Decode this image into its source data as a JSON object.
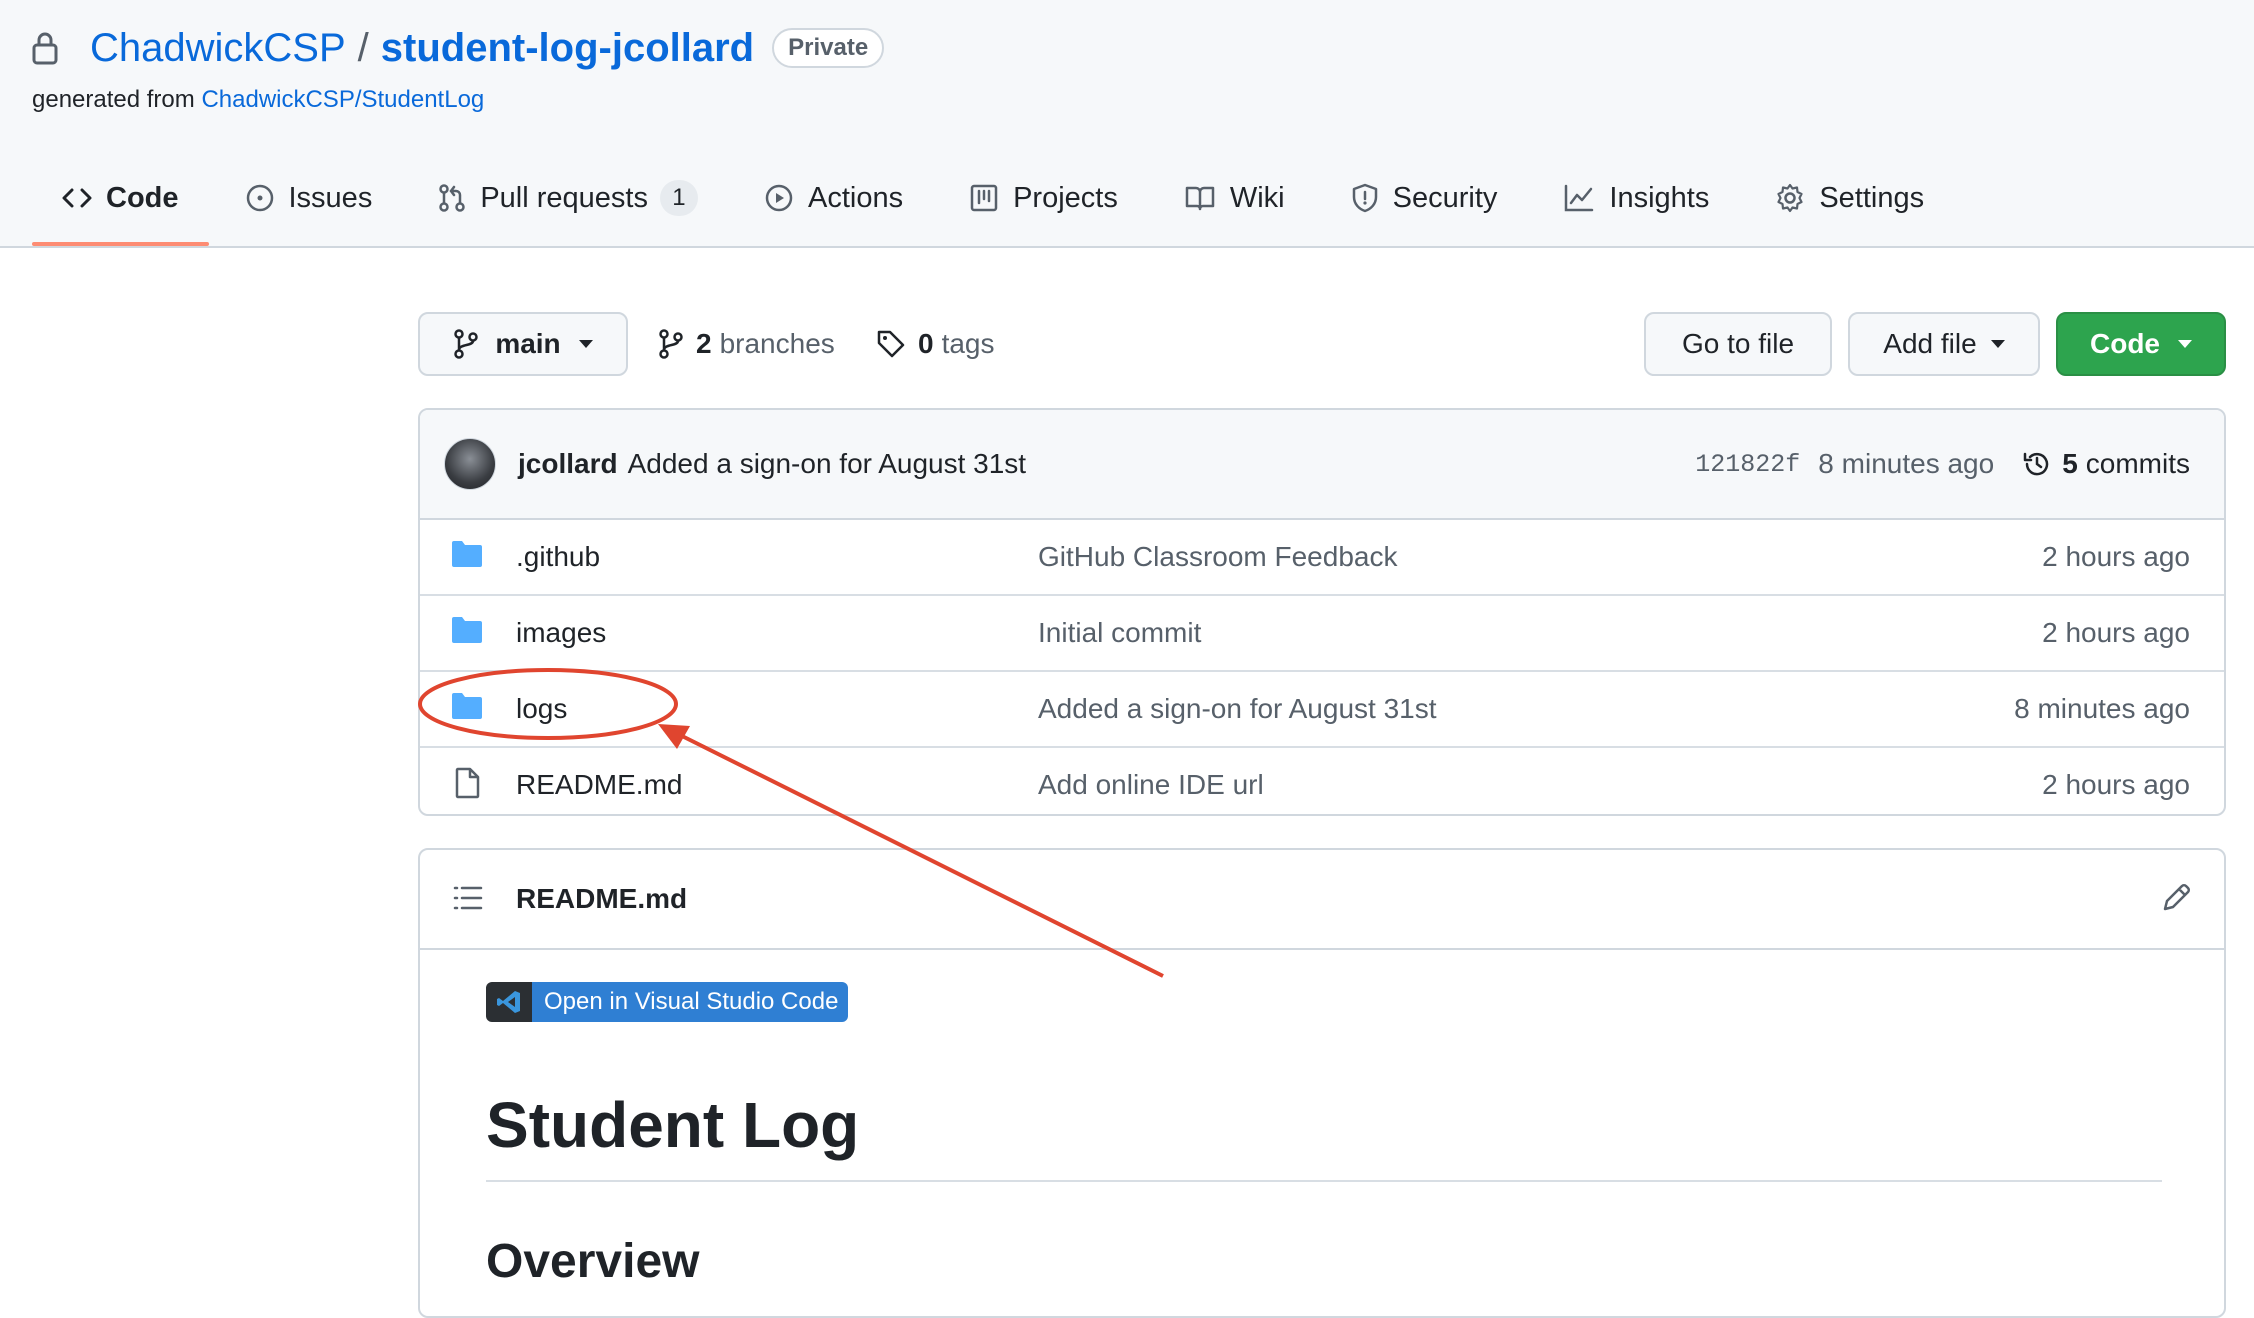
{
  "repo": {
    "owner": "ChadwickCSP",
    "separator": "/",
    "name": "student-log-jcollard",
    "visibility": "Private",
    "generated_prefix": "generated from ",
    "generated_source": "ChadwickCSP/StudentLog"
  },
  "tabs": [
    {
      "label": "Code",
      "icon": "code-icon",
      "selected": true
    },
    {
      "label": "Issues",
      "icon": "issue-icon"
    },
    {
      "label": "Pull requests",
      "icon": "pull-request-icon",
      "count": "1"
    },
    {
      "label": "Actions",
      "icon": "play-icon"
    },
    {
      "label": "Projects",
      "icon": "project-icon"
    },
    {
      "label": "Wiki",
      "icon": "book-icon"
    },
    {
      "label": "Security",
      "icon": "shield-icon"
    },
    {
      "label": "Insights",
      "icon": "graph-icon"
    },
    {
      "label": "Settings",
      "icon": "gear-icon"
    }
  ],
  "toolbar": {
    "branch": "main",
    "branches_count": "2",
    "branches_label": "branches",
    "tags_count": "0",
    "tags_label": "tags",
    "goto_file": "Go to file",
    "add_file": "Add file",
    "code": "Code"
  },
  "latest_commit": {
    "author": "jcollard",
    "message": "Added a sign-on for August 31st",
    "sha": "121822f",
    "age": "8 minutes ago",
    "commits_count": "5",
    "commits_label": "commits"
  },
  "files": [
    {
      "name": ".github",
      "type": "folder",
      "message": "GitHub Classroom Feedback",
      "age": "2 hours ago"
    },
    {
      "name": "images",
      "type": "folder",
      "message": "Initial commit",
      "age": "2 hours ago"
    },
    {
      "name": "logs",
      "type": "folder",
      "message": "Added a sign-on for August 31st",
      "age": "8 minutes ago"
    },
    {
      "name": "README.md",
      "type": "file",
      "message": "Add online IDE url",
      "age": "2 hours ago"
    }
  ],
  "readme": {
    "filename": "README.md",
    "badge_label": "Open in Visual Studio Code",
    "h1": "Student Log",
    "h2": "Overview"
  },
  "colors": {
    "link": "#0969da",
    "primary_button": "#2da44e",
    "selected_tab_underline": "#fd8c73",
    "folder_icon": "#54aeff",
    "annotation": "#e0452f"
  }
}
